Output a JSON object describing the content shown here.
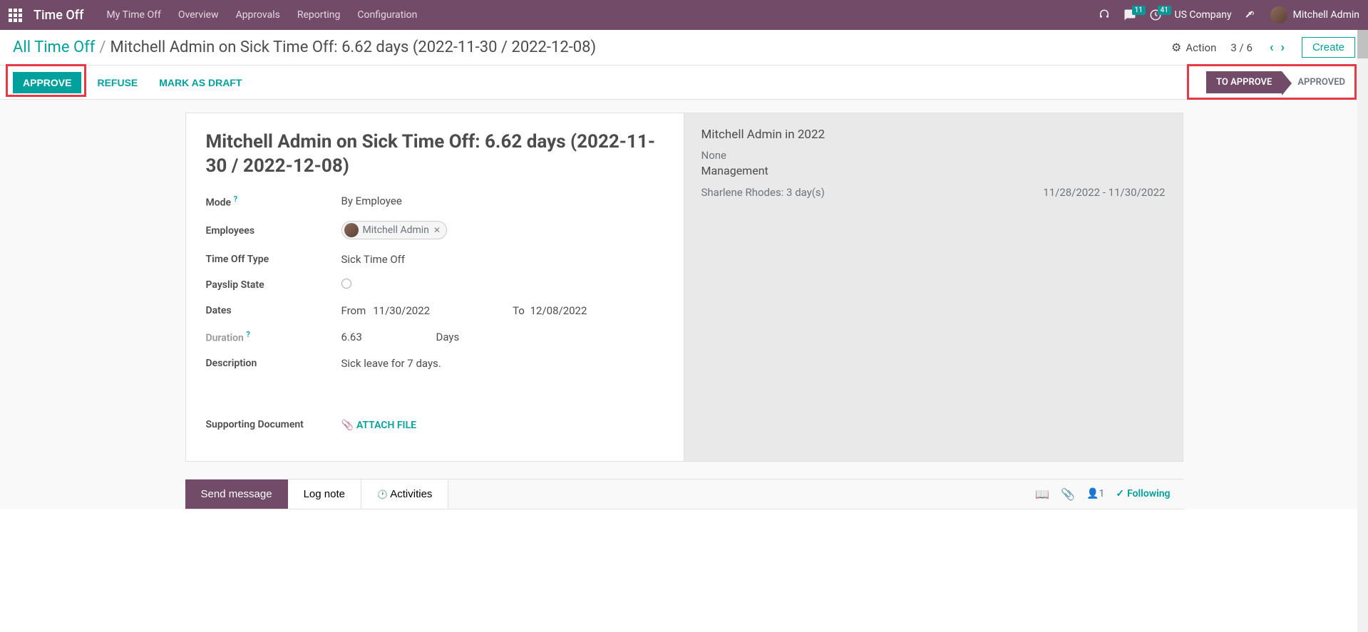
{
  "nav": {
    "app_title": "Time Off",
    "menu": [
      "My Time Off",
      "Overview",
      "Approvals",
      "Reporting",
      "Configuration"
    ],
    "chat_badge": "11",
    "activity_badge": "41",
    "company": "US Company",
    "user": "Mitchell Admin"
  },
  "breadcrumb": {
    "root": "All Time Off",
    "current": "Mitchell Admin on Sick Time Off: 6.62 days (2022-11-30 / 2022-12-08)"
  },
  "controls": {
    "action": "Action",
    "pager": "3 / 6",
    "create": "Create"
  },
  "actions": {
    "approve": "APPROVE",
    "refuse": "REFUSE",
    "mark_draft": "MARK AS DRAFT"
  },
  "status": {
    "active": "TO APPROVE",
    "next": "APPROVED"
  },
  "form": {
    "title": "Mitchell Admin on Sick Time Off: 6.62 days (2022-11-30 / 2022-12-08)",
    "mode_label": "Mode",
    "mode_value": "By Employee",
    "employees_label": "Employees",
    "employee_tag": "Mitchell Admin",
    "type_label": "Time Off Type",
    "type_value": "Sick Time Off",
    "payslip_label": "Payslip State",
    "dates_label": "Dates",
    "date_from_lbl": "From",
    "date_from": "11/30/2022",
    "date_to_lbl": "To",
    "date_to": "12/08/2022",
    "duration_label": "Duration",
    "duration_value": "6.63",
    "duration_unit": "Days",
    "description_label": "Description",
    "description_value": "Sick leave for 7 days.",
    "supporting_label": "Supporting Document",
    "attach_label": "ATTACH FILE"
  },
  "right_panel": {
    "title": "Mitchell Admin in 2022",
    "none": "None",
    "group": "Management",
    "entry_name": "Sharlene Rhodes: 3 day(s)",
    "entry_dates": "11/28/2022 - 11/30/2022"
  },
  "chatter": {
    "send": "Send message",
    "log": "Log note",
    "activities": "Activities",
    "follower_count": "1",
    "following": "Following"
  }
}
